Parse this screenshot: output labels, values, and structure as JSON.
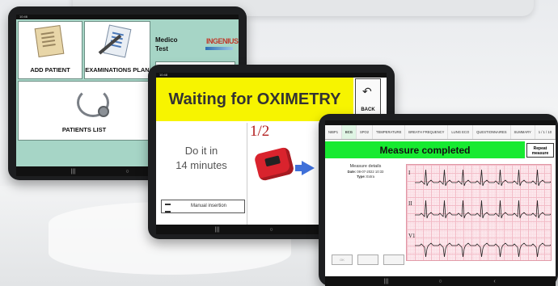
{
  "tablet_home": {
    "status_time": "10:46",
    "tiles": {
      "add_patient": "ADD PATIENT",
      "examinations_plan": "EXAMINATIONS PLAN",
      "patients_list": "PATIENTS LIST"
    },
    "doctor_name": "Medico\nTest",
    "brand_logo": "INGENIUS"
  },
  "tablet_oximetry": {
    "status_time": "10:48",
    "banner": "Waiting for OXIMETRY",
    "back_label": "BACK",
    "instruction": "Do it in\n14 minutes",
    "step_counter": "1/2",
    "manual_insertion_label": "Manual insertion"
  },
  "tablet_ecg": {
    "tabs": [
      "NIBP1",
      "ECG",
      "SPO2",
      "TEMPERATURE",
      "BREATH FREQUENCY",
      "LUNG ECO",
      "QUESTIONNAIRES",
      "SUMMARY",
      "1 / 1 / 10"
    ],
    "active_tab_index": 1,
    "title": "Measure completed",
    "repeat_label": "Repeat\nmeasure",
    "details_title": "Measure details",
    "date_label": "Date:",
    "date_value": "08-07-2022 10:33",
    "type_label": "Type:",
    "type_value": "Extra",
    "footer_buttons": [
      "OK",
      "",
      ""
    ],
    "leads": [
      "I",
      "II",
      "V1"
    ]
  },
  "colors": {
    "home_bg": "#a6d5c6",
    "oximetry_banner": "#f7f400",
    "completed_banner": "#17ea31",
    "ecg_grid": "#f2b9c5"
  }
}
